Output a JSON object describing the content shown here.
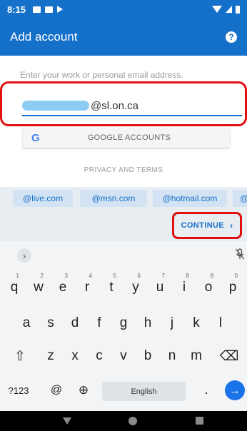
{
  "status_bar": {
    "time": "8:15"
  },
  "app_bar": {
    "title": "Add account",
    "help_icon": "?"
  },
  "email": {
    "prompt": "Enter your work or personal email address.",
    "domain_suffix": "@sl.on.ca"
  },
  "google_button": {
    "logo": "G",
    "label": "GOOGLE ACCOUNTS"
  },
  "privacy_link": "PRIVACY AND TERMS",
  "domain_suggestions": [
    "@live.com",
    "@msn.com",
    "@hotmail.com",
    "@"
  ],
  "continue_button": {
    "label": "CONTINUE",
    "chevron": "›"
  },
  "keyboard": {
    "expand": "›",
    "row1": [
      "q",
      "w",
      "e",
      "r",
      "t",
      "y",
      "u",
      "i",
      "o",
      "p"
    ],
    "row1_hints": [
      "1",
      "2",
      "3",
      "4",
      "5",
      "6",
      "7",
      "8",
      "9",
      "0"
    ],
    "row2": [
      "a",
      "s",
      "d",
      "f",
      "g",
      "h",
      "j",
      "k",
      "l"
    ],
    "shift": "⇧",
    "row3": [
      "z",
      "x",
      "c",
      "v",
      "b",
      "n",
      "m"
    ],
    "backspace": "⌫",
    "symbols": "?123",
    "at": "@",
    "globe": "⊕",
    "space_label": "English",
    "period": ".",
    "enter": "→"
  },
  "colors": {
    "accent": "#1570c9",
    "highlight": "#e01010",
    "blur": "#8ecdf3"
  }
}
